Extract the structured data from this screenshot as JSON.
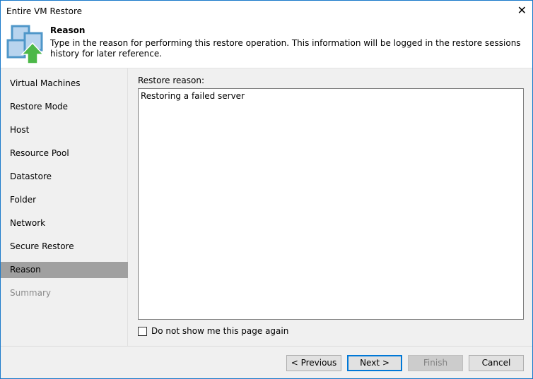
{
  "window": {
    "title": "Entire VM Restore",
    "close_label": "✕"
  },
  "header": {
    "title": "Reason",
    "description": "Type in the reason for performing this restore operation. This information will be logged in the restore sessions history for later reference."
  },
  "sidebar": {
    "items": [
      {
        "label": "Virtual Machines"
      },
      {
        "label": "Restore Mode"
      },
      {
        "label": "Host"
      },
      {
        "label": "Resource Pool"
      },
      {
        "label": "Datastore"
      },
      {
        "label": "Folder"
      },
      {
        "label": "Network"
      },
      {
        "label": "Secure Restore"
      },
      {
        "label": "Reason"
      },
      {
        "label": "Summary"
      }
    ]
  },
  "main": {
    "reason_label": "Restore reason:",
    "reason_value": "Restoring a failed server",
    "dont_show_label": "Do not show me this page again"
  },
  "footer": {
    "previous": "< Previous",
    "next": "Next >",
    "finish": "Finish",
    "cancel": "Cancel"
  }
}
